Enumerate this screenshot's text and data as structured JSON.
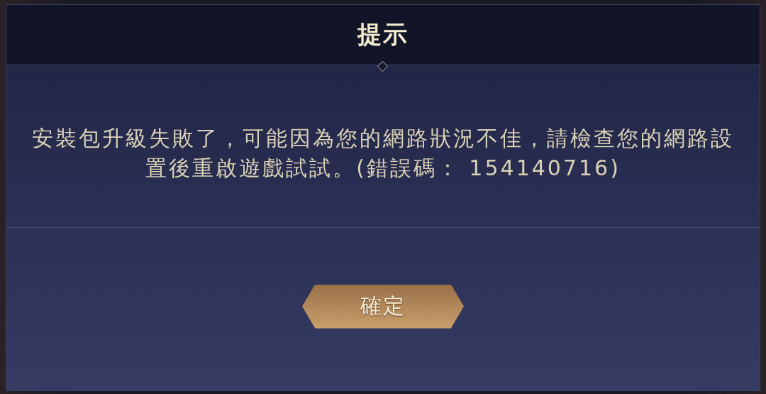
{
  "dialog": {
    "title": "提示",
    "message": "安裝包升級失敗了，可能因為您的網路狀況不佳，請檢查您的網路設置後重啟遊戲試試。(錯誤碼： 154140716)",
    "buttons": [
      {
        "label": "確定"
      }
    ]
  }
}
